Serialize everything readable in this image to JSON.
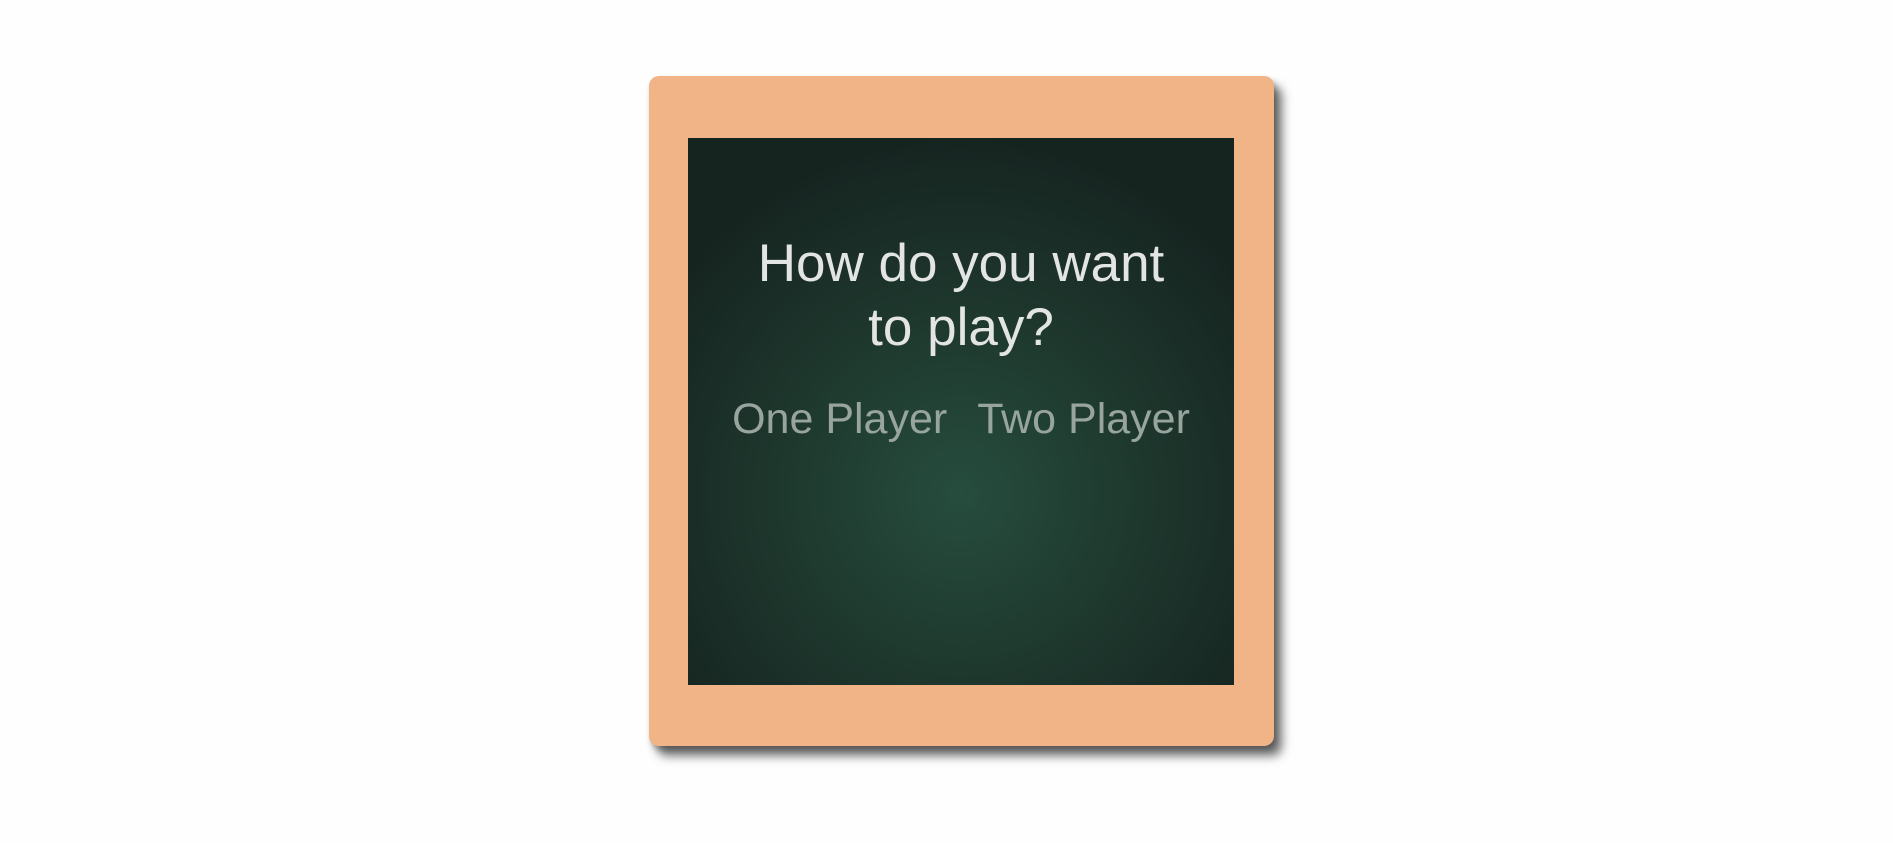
{
  "dialog": {
    "prompt": "How do you want to play?",
    "options": [
      {
        "label": "One Player"
      },
      {
        "label": "Two Player"
      }
    ]
  },
  "colors": {
    "frame": "#f0b487",
    "board_center": "#264d3e",
    "board_edge": "#162420",
    "prompt_text": "#e2e5e3",
    "option_text": "#97a59e"
  }
}
